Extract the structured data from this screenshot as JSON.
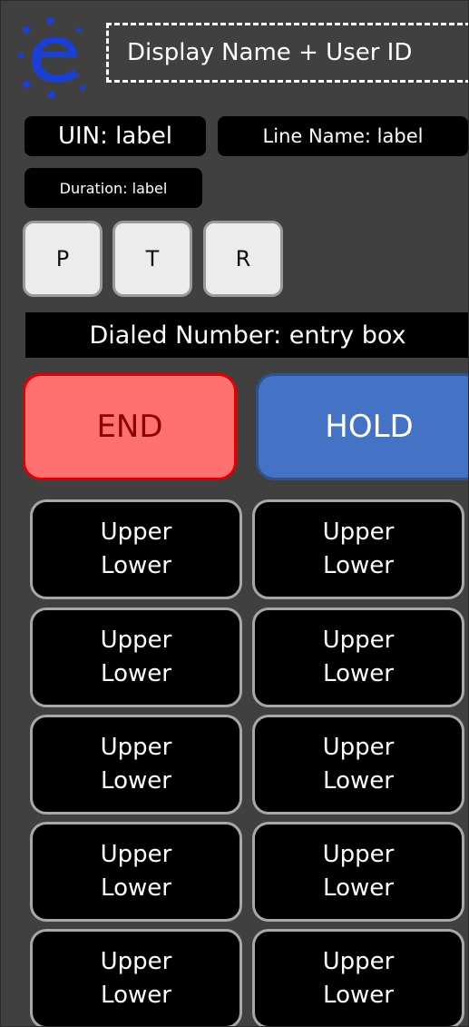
{
  "header": {
    "display_name": "Display Name + User ID"
  },
  "info": {
    "uin": "UIN: label",
    "line_name": "Line Name: label",
    "duration": "Duration: label"
  },
  "ptr_buttons": {
    "p": "P",
    "t": "T",
    "r": "R"
  },
  "dialed_number": "Dialed Number: entry box",
  "call_controls": {
    "end": "END",
    "hold": "HOLD"
  },
  "line_keys": [
    {
      "upper": "Upper",
      "lower": "Lower"
    },
    {
      "upper": "Upper",
      "lower": "Lower"
    },
    {
      "upper": "Upper",
      "lower": "Lower"
    },
    {
      "upper": "Upper",
      "lower": "Lower"
    },
    {
      "upper": "Upper",
      "lower": "Lower"
    },
    {
      "upper": "Upper",
      "lower": "Lower"
    },
    {
      "upper": "Upper",
      "lower": "Lower"
    },
    {
      "upper": "Upper",
      "lower": "Lower"
    },
    {
      "upper": "Upper",
      "lower": "Lower"
    },
    {
      "upper": "Upper",
      "lower": "Lower"
    }
  ],
  "colors": {
    "background": "#404040",
    "end_button": "#ff7070",
    "hold_button": "#4472c4",
    "logo": "#1a3fd6"
  },
  "icons": {
    "logo": "e-logo-icon"
  }
}
